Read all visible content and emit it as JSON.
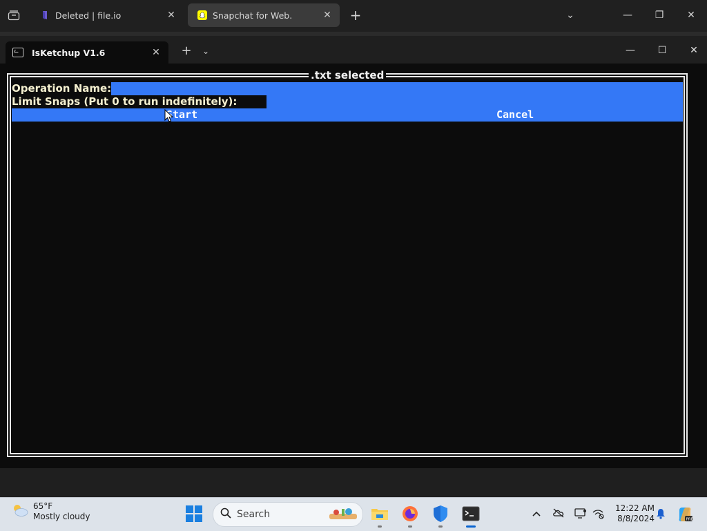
{
  "browser": {
    "tabs": [
      {
        "title": "Deleted | file.io",
        "icon": "file-io-icon",
        "active": false
      },
      {
        "title": "Snapchat for Web.",
        "icon": "snapchat-icon",
        "active": true
      }
    ],
    "new_tab": "+",
    "controls": {
      "tab_list": "⌄",
      "minimize": "—",
      "restore": "❐",
      "close": "✕"
    },
    "close_glyph": "✕"
  },
  "terminal": {
    "tab_title": "IsKetchup V1.6",
    "tab_close": "✕",
    "new_tab": "+",
    "dropdown": "⌄",
    "controls": {
      "minimize": "—",
      "maximize": "☐",
      "close": "✕"
    },
    "dialog": {
      "title": ".txt selected",
      "field_operation": "Operation Name:",
      "field_limit": "Limit Snaps (Put 0 to run indefinitely):",
      "start_button": "Start",
      "cancel_button": "Cancel"
    },
    "colors": {
      "highlight": "#3478f6",
      "background": "#0c0c0c",
      "label": "#f5f0d0"
    }
  },
  "taskbar": {
    "weather": {
      "temp": "65°F",
      "condition": "Mostly cloudy"
    },
    "search_placeholder": "Search",
    "apps": [
      "windows-start-icon",
      "file-explorer-icon",
      "firefox-icon",
      "defender-icon",
      "terminal-icon"
    ],
    "tray": [
      "chevron-up-icon",
      "onedrive-icon",
      "display-icon",
      "network-icon",
      "notification-bell-icon",
      "copilot-icon"
    ],
    "time": "12:22 AM",
    "date": "8/8/2024"
  }
}
